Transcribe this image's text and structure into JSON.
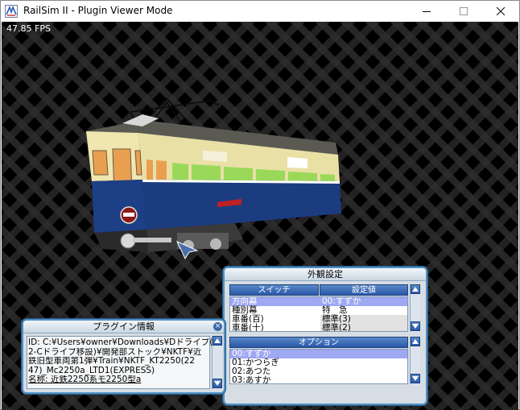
{
  "window": {
    "title": "RailSim II - Plugin Viewer Mode",
    "icons": {
      "app": "railsim-icon",
      "minimize": "minimize-icon",
      "maximize": "maximize-icon",
      "close": "close-icon"
    }
  },
  "viewport": {
    "fps": "47.85 FPS"
  },
  "appearance_panel": {
    "title": "外観設定",
    "switch_header": {
      "switch": "スイッチ",
      "value": "設定値"
    },
    "switch_rows": [
      {
        "name": "方向幕",
        "value": "00:すずか",
        "selected": true
      },
      {
        "name": "種別幕",
        "value": "特　急",
        "selected": false
      },
      {
        "name": "車番(百)",
        "value": "標準(3)",
        "selected": false
      },
      {
        "name": "車番(十)",
        "value": "標準(2)",
        "selected": false
      }
    ],
    "option_header": "オプション",
    "option_rows": [
      {
        "label": "00:すずか",
        "selected": true
      },
      {
        "label": "01:かつらぎ",
        "selected": false
      },
      {
        "label": "02:あつた",
        "selected": false
      },
      {
        "label": "03:あすか",
        "selected": false
      }
    ]
  },
  "plugin_panel": {
    "title": "プラグイン情報",
    "lines": [
      "ID: C:¥Users¥owner¥Downloads¥Dドライブ(",
      "2-Cドライブ移設)¥開発部ストック¥NKTF¥近",
      "鉄旧型車両第1弾¥Train¥NKTF_KT2250(22",
      "47)_Mc2250a_LTD1(EXPRESS)",
      "名称: 近鉄2250系モ2250型a"
    ]
  },
  "colors": {
    "panel_border": "#4e8fc2",
    "header_blue": "#2a58a8",
    "selection": "#9fa8f2",
    "train_cream": "#efe6b0",
    "train_blue": "#1d3f86"
  }
}
